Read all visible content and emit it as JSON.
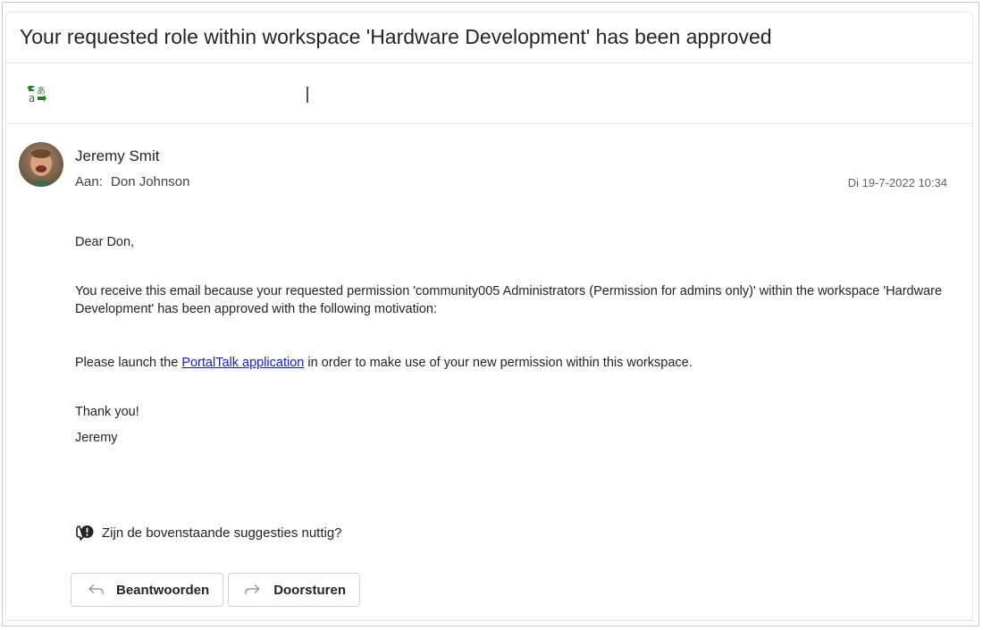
{
  "subject": "Your requested role within workspace 'Hardware Development' has been approved",
  "toolbar": {
    "translate_icon": "translate-icon"
  },
  "sender": {
    "name": "Jeremy Smit",
    "to_label": "Aan:",
    "to_name": "Don Johnson",
    "date": "Di 19-7-2022 10:34"
  },
  "body": {
    "greeting": "Dear Don,",
    "paragraph": "You receive this email because your requested permission 'community005 Administrators (Permission for admins only)' within the workspace 'Hardware Development' has been approved with the following motivation:",
    "launch_before": "Please launch the ",
    "launch_link": "PortalTalk application",
    "launch_after": " in order to make use of your new permission within this workspace.",
    "thanks": "Thank you!",
    "signature": "Jeremy"
  },
  "feedback": {
    "text": "Zijn de bovenstaande suggesties nuttig?",
    "icon": "feedback-icon"
  },
  "actions": {
    "reply_label": "Beantwoorden",
    "forward_label": "Doorsturen"
  },
  "colors": {
    "translate_green": "#2a7b2a",
    "link_blue": "#0f1ddb"
  }
}
